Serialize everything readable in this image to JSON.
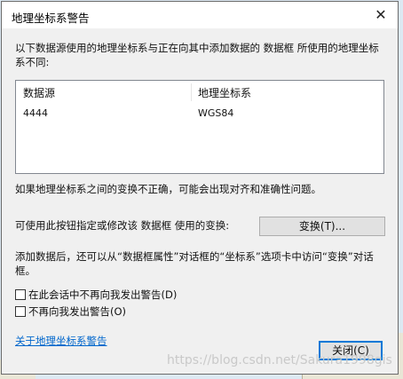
{
  "window": {
    "title": "地理坐标系警告",
    "close_glyph": "✕"
  },
  "intro_text": "以下数据源使用的地理坐标系与正在向其中添加数据的 数据框 所使用的地理坐标系不同:",
  "table": {
    "columns": [
      "数据源",
      "地理坐标系"
    ],
    "rows": [
      [
        "4444",
        "WGS84"
      ]
    ]
  },
  "warning_text": "如果地理坐标系之间的变换不正确，可能会出现对齐和准确性问题。",
  "transform_hint": "可使用此按钮指定或修改该 数据框 使用的变换:",
  "transform_button": "变换(T)...",
  "explain_text": "添加数据后，还可以从“数据框属性”对话框的“坐标系”选项卡中访问“变换”对话框。",
  "checkboxes": [
    {
      "label": "在此会话中不再向我发出警告(D)",
      "checked": false
    },
    {
      "label": "不再向我发出警告(O)",
      "checked": false
    }
  ],
  "about_link": "关于地理坐标系警告",
  "close_button": "关闭(C)",
  "watermark": "https://blog.csdn.net/Sakura1998gis"
}
